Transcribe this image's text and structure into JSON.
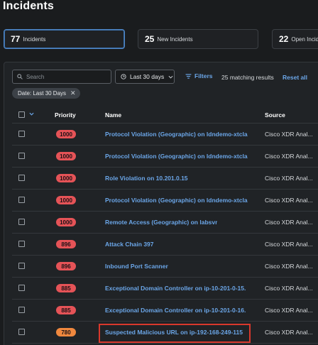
{
  "page": {
    "title": "Incidents"
  },
  "stats": [
    {
      "count": "77",
      "label": "Incidents",
      "active": true
    },
    {
      "count": "25",
      "label": "New Incidents",
      "active": false
    },
    {
      "count": "22",
      "label": "Open Incidents",
      "active": false
    }
  ],
  "toolbar": {
    "search_placeholder": "Search",
    "date_range": "Last 30 days",
    "filters_label": "Filters",
    "matching_results": "25 matching results",
    "reset_label": "Reset all"
  },
  "active_filter_chip": "Date: Last 30 Days",
  "table": {
    "columns": {
      "priority": "Priority",
      "name": "Name",
      "source": "Source"
    },
    "rows": [
      {
        "priority": "1000",
        "name": "Protocol Violation (Geographic) on ldndemo-xtcla",
        "source": "Cisco XDR Anal..."
      },
      {
        "priority": "1000",
        "name": "Protocol Violation (Geographic) on ldndemo-xtcla",
        "source": "Cisco XDR Anal..."
      },
      {
        "priority": "1000",
        "name": "Role Violation on 10.201.0.15",
        "source": "Cisco XDR Anal..."
      },
      {
        "priority": "1000",
        "name": "Protocol Violation (Geographic) on ldndemo-xtcla",
        "source": "Cisco XDR Anal..."
      },
      {
        "priority": "1000",
        "name": "Remote Access (Geographic) on labsvr",
        "source": "Cisco XDR Anal..."
      },
      {
        "priority": "896",
        "name": "Attack Chain 397",
        "source": "Cisco XDR Anal..."
      },
      {
        "priority": "896",
        "name": "Inbound Port Scanner",
        "source": "Cisco XDR Anal..."
      },
      {
        "priority": "885",
        "name": "Exceptional Domain Controller on ip-10-201-0-15.",
        "source": "Cisco XDR Anal..."
      },
      {
        "priority": "885",
        "name": "Exceptional Domain Controller on ip-10-201-0-16.",
        "source": "Cisco XDR Anal..."
      },
      {
        "priority": "780",
        "name": "Suspected Malicious URL on ip-192-168-249-115",
        "source": "Cisco XDR Anal..."
      }
    ]
  },
  "colors": {
    "background": "#1a1c1e",
    "link": "#6ba6e8",
    "priority_high": "#e55357",
    "priority_medium": "#f0883e",
    "highlight": "#d9382c"
  },
  "icons": {
    "search": "search-icon",
    "calendar": "clock-icon",
    "filters": "filter-lines-icon",
    "chip_close": "close-icon",
    "select_chevron": "chevron-down-icon"
  }
}
